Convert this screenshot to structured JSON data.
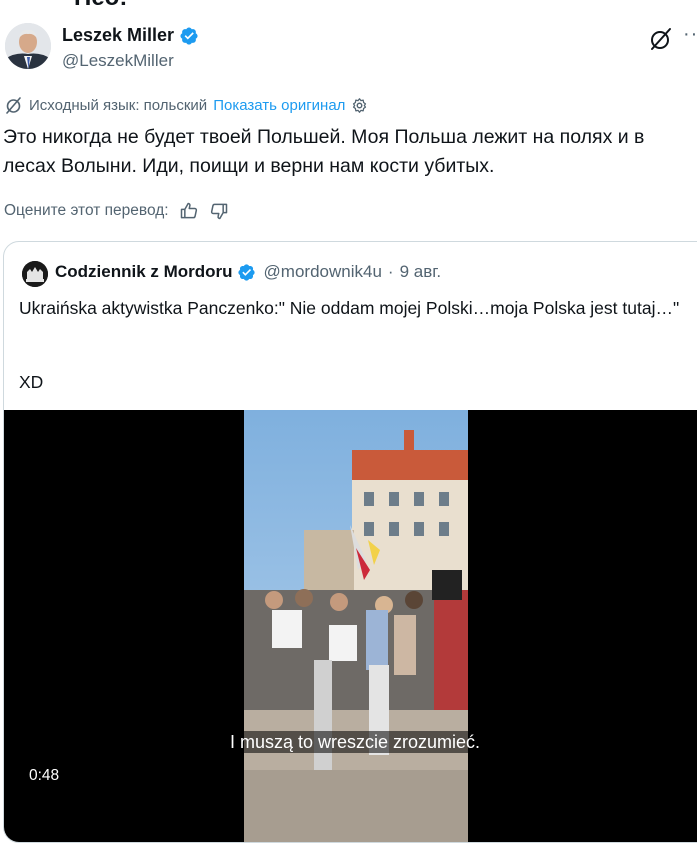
{
  "top_partial_text": "Нео:",
  "author": {
    "name": "Leszek Miller",
    "handle": "@LeszekMiller",
    "verified": true
  },
  "icons": {
    "grok": "grok-icon",
    "more": "more-icon",
    "translate": "translate-icon",
    "settings": "settings-icon",
    "thumb_up": "thumb-up-icon",
    "thumb_down": "thumb-down-icon",
    "verified": "verified-badge-icon"
  },
  "translation": {
    "source_label": "Исходный язык: польский",
    "show_original": "Показать оригинал",
    "rate_label": "Оцените этот перевод:"
  },
  "tweet_text": "Это никогда не будет твоей Польшей. Моя Польша лежит на полях и в лесах Волыни. Иди, поищи и верни нам кости убитых.",
  "quote": {
    "name": "Codziennik z Mordoru",
    "handle": "@mordownik4u",
    "separator": "·",
    "date": "9 авг.",
    "text": "Ukraińska aktywistka Panczenko:\" Nie oddam mojej Polski…moja Polska jest tutaj…\"",
    "xd": "XD"
  },
  "video": {
    "subtitle": "I muszą to wreszcie zrozumieć.",
    "duration": "0:48"
  },
  "colors": {
    "accent": "#1d9bf0",
    "secondary_text": "#536471",
    "primary_text": "#0f1419",
    "border": "#cfd9de"
  }
}
